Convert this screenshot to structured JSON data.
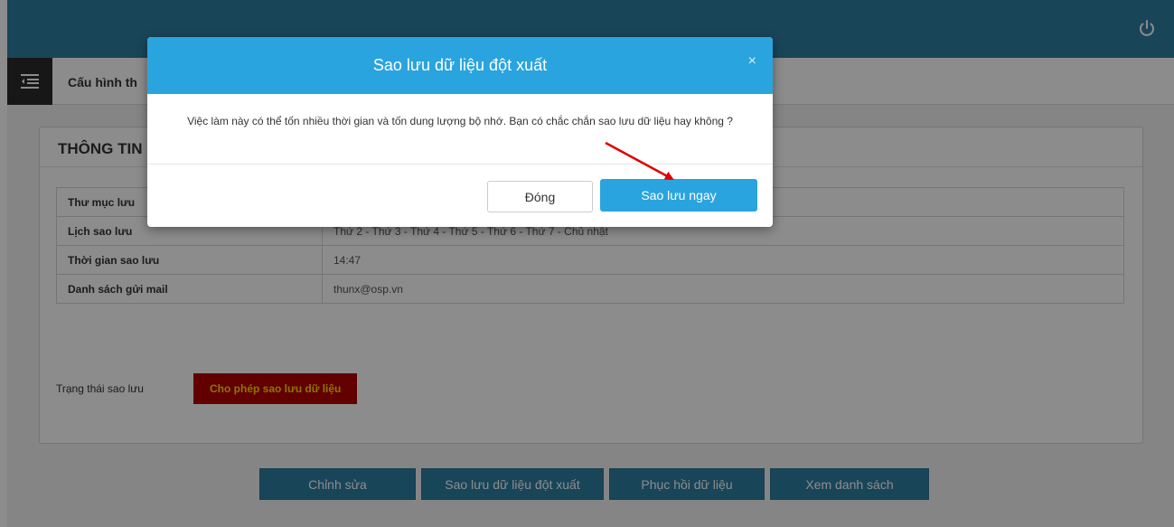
{
  "header": {
    "power_icon": "power-icon"
  },
  "subheader": {
    "menu_icon": "menu-collapse-icon",
    "breadcrumb": "Cấu hình th"
  },
  "panel": {
    "title": "THÔNG TIN",
    "rows": [
      {
        "label": "Thư mục lưu",
        "value": ""
      },
      {
        "label": "Lịch sao lưu",
        "value": "Thứ 2 - Thứ 3 - Thứ 4 - Thứ 5 - Thứ 6 - Thứ 7 - Chủ nhật"
      },
      {
        "label": "Thời gian sao lưu",
        "value": "14:47"
      },
      {
        "label": "Danh sách gửi mail",
        "value": "thunx@osp.vn"
      }
    ],
    "status_label": "Trạng thái sao lưu",
    "status_badge": "Cho phép sao lưu dữ liệu"
  },
  "actions": {
    "edit": "Chỉnh sửa",
    "backup_now": "Sao lưu dữ liệu đột xuất",
    "restore": "Phục hồi dữ liệu",
    "view_list": "Xem danh sách"
  },
  "modal": {
    "title": "Sao lưu dữ liệu đột xuất",
    "close_symbol": "×",
    "message": "Việc làm này có thể tốn nhiều thời gian và tốn dung lượng bộ nhớ. Bạn có chắc chắn sao lưu dữ liệu hay không ?",
    "cancel_label": "Đóng",
    "confirm_label": "Sao lưu ngay"
  },
  "colors": {
    "header": "#2e7ea3",
    "modal_header": "#2aa4de",
    "status_badge_bg": "#b30000",
    "status_badge_text": "#ffd700",
    "annotation_arrow": "#e00000"
  }
}
